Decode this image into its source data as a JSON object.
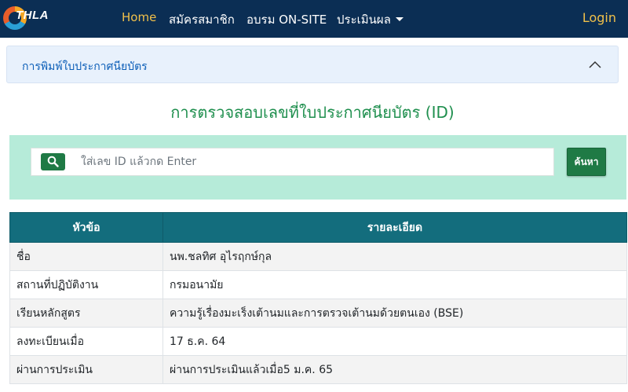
{
  "brand": {
    "logo_text": "THLA"
  },
  "nav": {
    "items": [
      {
        "label": "Home",
        "active": true
      },
      {
        "label": "สมัครสมาชิก"
      },
      {
        "label": "อบรม ON-SITE"
      },
      {
        "label": "ประเมินผล",
        "dropdown": true
      }
    ],
    "login_label": "Login"
  },
  "accordion": {
    "title": "การพิมพ์ใบประกาศนียบัตร",
    "state": "expanded"
  },
  "main": {
    "title": "การตรวจสอบเลขที่ใบประกาศนียบัตร (ID)"
  },
  "search": {
    "placeholder": "ใส่เลข ID แล้วกด Enter",
    "value": "",
    "button_label": "ค้นหา"
  },
  "table": {
    "headers": [
      "หัวข้อ",
      "รายละเอียด"
    ],
    "rows": [
      [
        "ชื่อ",
        "นพ.ชลทิศ อุไรฤกษ์กุล"
      ],
      [
        "สถานที่ปฏิบัติงาน",
        "กรมอนามัย"
      ],
      [
        "เรียนหลักสูตร",
        "ความรู้เรื่องมะเร็งเต้านมและการตรวจเต้านมด้วยตนเอง (BSE)"
      ],
      [
        "ลงทะเบียนเมื่อ",
        "17 ธ.ค. 64"
      ],
      [
        "ผ่านการประเมิน",
        "ผ่านการประเมินแล้วเมื่อ5 ม.ค. 65"
      ]
    ]
  },
  "colors": {
    "navbar": "#0b2e54",
    "nav_active": "#f0c04a",
    "title_green": "#1f8f4e",
    "search_panel": "#b6ebd9",
    "button_green": "#1f7a45",
    "table_header": "#136d7d",
    "accordion_bg": "#e8f1fc",
    "accordion_text": "#0d5fb8"
  },
  "icons": {
    "logo": "thla-logo-icon",
    "search": "search-icon",
    "accordion": "chevron-up-icon",
    "dropdown": "caret-down-icon"
  }
}
